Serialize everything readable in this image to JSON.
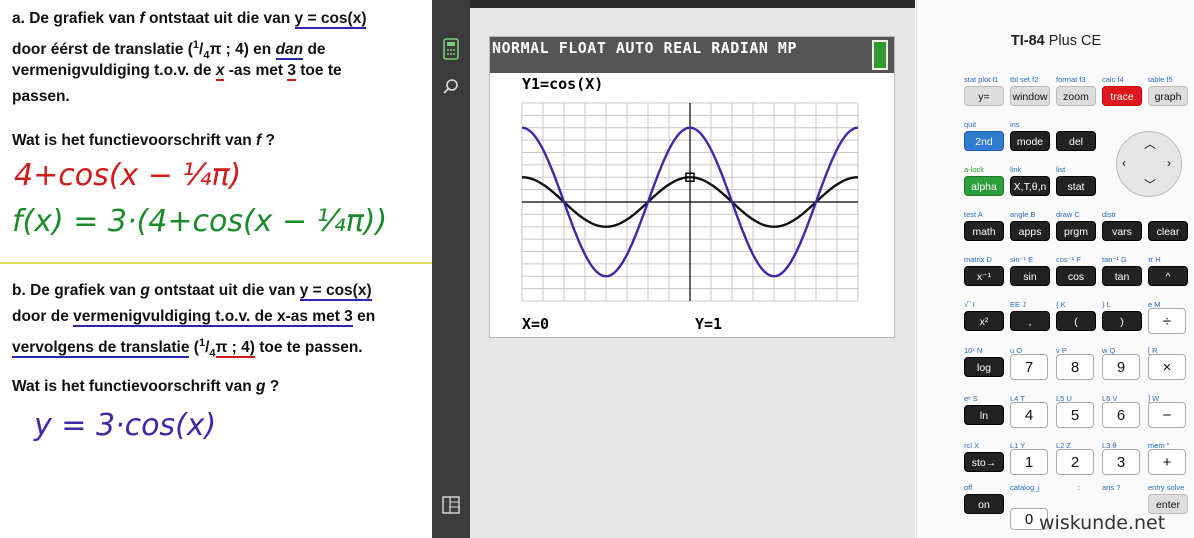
{
  "board": {
    "qa": {
      "line1a": "a. De grafiek van ",
      "line1f": "f",
      "line1b": " ontstaat uit die van ",
      "line1eq": "y = cos(x)",
      "line2a": "door éérst de translatie (",
      "frac_num": "1",
      "frac_den": "/",
      "frac_sub": "4",
      "line2b": "π ; 4) en ",
      "line2dan": "dan",
      "line2c": "  de",
      "line3a": "vermenigvuldiging t.o.v. de ",
      "line3x": "x",
      "line3b": " -as met ",
      "line3n": "3",
      "line3c": " toe te",
      "line4": "passen.",
      "question": "Wat is het functievoorschrift van ",
      "question_f": "f",
      "question_end": " ?"
    },
    "handwriting_a1": "4+cos(x − ¼π)",
    "handwriting_a2": "f(x) = 3·(4+cos(x − ¼π))",
    "qb": {
      "line1a": "b. De grafiek van ",
      "line1g": "g",
      "line1b": "  ontstaat uit die van ",
      "line1eq": "y = cos(x)",
      "line2a": "door de ",
      "line2u": "vermenigvuldiging t.o.v. de x-as met 3",
      "line2b": " en",
      "line3u": "vervolgens de translatie",
      "line3a": " (",
      "frac_num": "1",
      "frac_den": "/",
      "frac_sub": "4",
      "line3b": "π ; 4)",
      "line3c": " toe te passen.",
      "question": "Wat is het functievoorschrift van ",
      "question_g": "g",
      "question_end": " ?"
    },
    "handwriting_b1": "y = 3·cos(x)"
  },
  "calc_screen": {
    "status": "NORMAL FLOAT AUTO REAL RADIAN MP",
    "y1": "Y1=cos(X)",
    "x_readout": "X=0",
    "y_readout": "Y=1"
  },
  "calc_keys": {
    "title_bold": "TI-84",
    "title_rest": " Plus CE",
    "row1_labels": [
      "stat plot  f1",
      "tbl set  f2",
      "format  f3",
      "calc  f4",
      "table  f5"
    ],
    "row1": [
      "y=",
      "window",
      "zoom",
      "trace",
      "graph"
    ],
    "row2_top": [
      "quit",
      "ins"
    ],
    "row2": [
      "2nd",
      "mode",
      "del"
    ],
    "row3_top": [
      "a-lock",
      "link",
      "list"
    ],
    "row3": [
      "alpha",
      "X,T,θ,n",
      "stat"
    ],
    "row4_top": [
      "test  A",
      "angle  B",
      "draw  C",
      "distr"
    ],
    "row4": [
      "math",
      "apps",
      "prgm",
      "vars",
      "clear"
    ],
    "row5_top": [
      "matrix  D",
      "sin⁻¹  E",
      "cos⁻¹  F",
      "tan⁻¹  G",
      "π   H"
    ],
    "row5": [
      "x⁻¹",
      "sin",
      "cos",
      "tan",
      "^"
    ],
    "row6_top": [
      "√‾   I",
      "EE   J",
      "{   K",
      "}   L",
      "e   M"
    ],
    "row6": [
      "x²",
      ",",
      "(",
      ")",
      "÷"
    ],
    "row7_top": [
      "10ˣ  N",
      "u   O",
      "v   P",
      "w   Q",
      "[   R"
    ],
    "row7": [
      "log",
      "7",
      "8",
      "9",
      "×"
    ],
    "row8_top": [
      "eˣ   S",
      "L4   T",
      "L5   U",
      "L6   V",
      "]   W"
    ],
    "row8": [
      "ln",
      "4",
      "5",
      "6",
      "−"
    ],
    "row9_top": [
      "rcl   X",
      "L1   Y",
      "L2   Z",
      "L3   θ",
      "mem  \""
    ],
    "row9": [
      "sto→",
      "1",
      "2",
      "3",
      "+"
    ],
    "row10_top": [
      "off",
      "catalog  ⎵",
      "i",
      ":",
      "ans   ?",
      "entry solve"
    ],
    "row10": [
      "on",
      "0",
      "enter"
    ],
    "brand": "wiskunde.net"
  },
  "chart_data": {
    "type": "line",
    "title": "",
    "xlabel": "",
    "ylabel": "",
    "xlim": [
      -6.2832,
      6.2832
    ],
    "ylim": [
      -4,
      4
    ],
    "grid": true,
    "series": [
      {
        "name": "Y1=cos(X)",
        "expr": "cos(x)",
        "color": "#111111"
      },
      {
        "expr": "3cos(x)",
        "color": "#3b2aa8"
      }
    ],
    "trace_point": {
      "x": 0,
      "y": 1
    }
  },
  "colors": {
    "accent_blue": "#2a2aa8",
    "handwriting_red": "#d11a1a",
    "handwriting_green": "#1a8a2a",
    "trace_red": "#e0171f",
    "second_blue": "#2e7bd0",
    "alpha_green": "#2c9e3c"
  }
}
